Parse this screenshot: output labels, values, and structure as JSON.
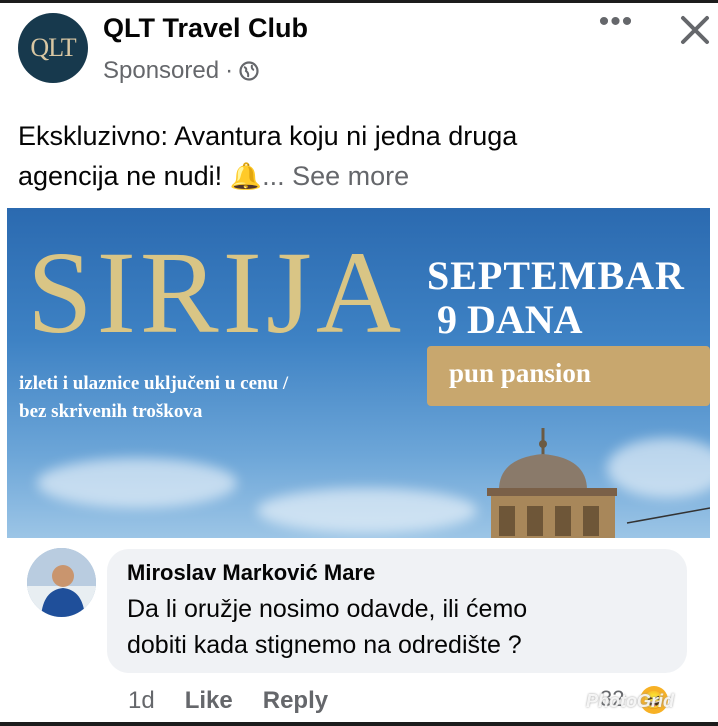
{
  "post": {
    "page_name": "QLT Travel Club",
    "avatar_text": "QLT",
    "sponsored_label": "Sponsored",
    "separator": "·",
    "more_label": "•••",
    "text_line1": "Ekskluzivno: Avantura koju ni jedna druga",
    "text_line2_prefix": "agencija ne nudi!",
    "bell_emoji": "🔔",
    "see_more": "... See more"
  },
  "banner": {
    "title": "SIRIJA",
    "month": "SEPTEMBAR",
    "duration": "9 DANA",
    "board": "pun pansion",
    "included_line1": "izleti i ulaznice uključeni u cenu /",
    "included_line2": "bez skrivenih troškova"
  },
  "comment": {
    "author": "Miroslav Marković Mare",
    "text_line1": "Da li oružje nosimo odavde, ili ćemo",
    "text_line2": "dobiti kada stignemo na odredište ?",
    "time": "1d",
    "like_label": "Like",
    "reply_label": "Reply",
    "reaction_count": "32",
    "reaction_emoji": "😆"
  },
  "watermark": "PhotoGrid",
  "icons": [
    "globe-icon",
    "more-icon",
    "close-icon",
    "bell-icon",
    "haha-reaction-icon"
  ]
}
